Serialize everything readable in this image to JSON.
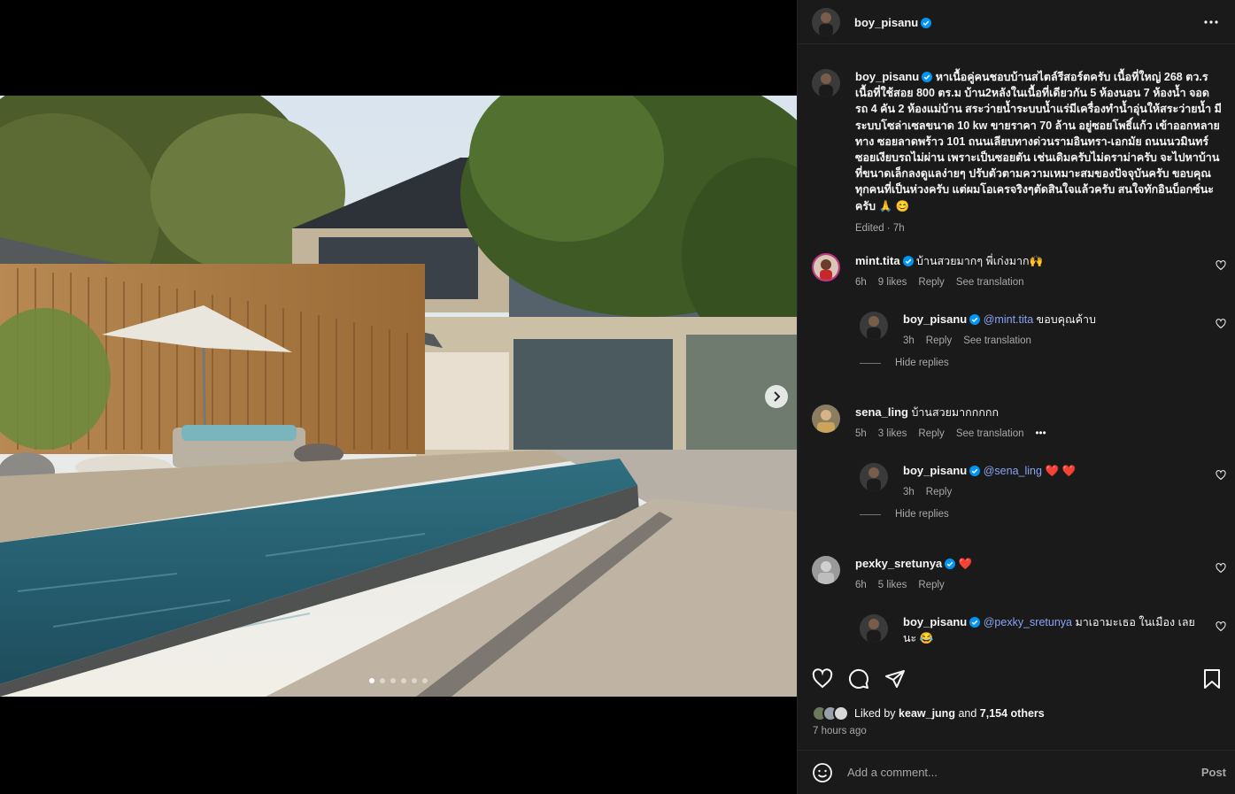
{
  "post": {
    "author": "boy_pisanu",
    "caption": "หาเนื้อคู่คนชอบบ้านสไตล์รีสอร์ตครับ เนื้อที่ใหญ่ 268 ตว.ร เนื้อที่ใช้สอย 800 ตร.ม บ้าน2หลังในเนื้อที่เดียวกัน 5 ห้องนอน 7 ห้องน้ำ จอดรถ 4 คัน 2 ห้องแม่บ้าน สระว่ายน้ำระบบน้ำแร่มีเครื่องทำน้ำอุ่นให้สระว่ายน้ำ มีระบบโซล่าเซลขนาด 10 kw ขายราคา 70 ล้าน อยู่ซอยโพธิ์แก้ว เข้าออกหลายทาง ซอยลาดพร้าว 101 ถนนเลียบทางด่วนรามอินทรา-เอกมัย ถนนนวมินทร์ ซอยเงียบรถไม่ผ่าน เพราะเป็นซอยตัน เช่นเดิมครับไม่ดราม่าครับ จะไปหาบ้านที่ขนาดเล็กลงดูแลง่ายๆ ปรับตัวตามความเหมาะสมของปัจจุบันครับ ขอบคุณทุกคนที่เป็นห่วงครับ แต่ผมโอเครจริงๆตัดสินใจแล้วครับ สนใจทักอินบ็อกซ์นะครับ 🙏 😊",
    "edited": "Edited · 7h",
    "likes_prefix": "Liked by",
    "liked_by": "keaw_jung",
    "likes_joiner": "and",
    "likes_others": "7,154 others",
    "time_ago": "7 hours ago",
    "add_comment_placeholder": "Add a comment...",
    "post_label": "Post",
    "carousel_slides": 6,
    "carousel_active": 0
  },
  "comments": [
    {
      "user": "mint.tita",
      "verified": true,
      "text": "บ้านสวยมากๆ พี่เก่งมาก🙌",
      "time": "6h",
      "likes": "9 likes",
      "reply": "Reply",
      "translate": "See translation",
      "replies": [
        {
          "user": "boy_pisanu",
          "mention": "@mint.tita",
          "text": "ขอบคุณค้าบ",
          "time": "3h",
          "reply": "Reply",
          "translate": "See translation"
        }
      ],
      "hide_replies": "Hide replies"
    },
    {
      "user": "sena_ling",
      "verified": false,
      "text": "บ้านสวยมากกกกก",
      "time": "5h",
      "likes": "3 likes",
      "reply": "Reply",
      "translate": "See translation",
      "more": "•••",
      "replies": [
        {
          "user": "boy_pisanu",
          "mention": "@sena_ling",
          "text": "❤️ ❤️",
          "time": "3h",
          "reply": "Reply"
        }
      ],
      "hide_replies": "Hide replies"
    },
    {
      "user": "pexky_sretunya",
      "verified": true,
      "text": "❤️",
      "time": "6h",
      "likes": "5 likes",
      "reply": "Reply",
      "replies": [
        {
          "user": "boy_pisanu",
          "mention": "@pexky_sretunya",
          "text": "มาเอามะเธอ ในเมือง เลยนะ 😂"
        }
      ]
    }
  ],
  "colors": {
    "panel_bg": "#1a1a1a",
    "verified_blue": "#0095f6",
    "mention_blue": "#8aa4f5",
    "muted_text": "#a8a8a8"
  }
}
